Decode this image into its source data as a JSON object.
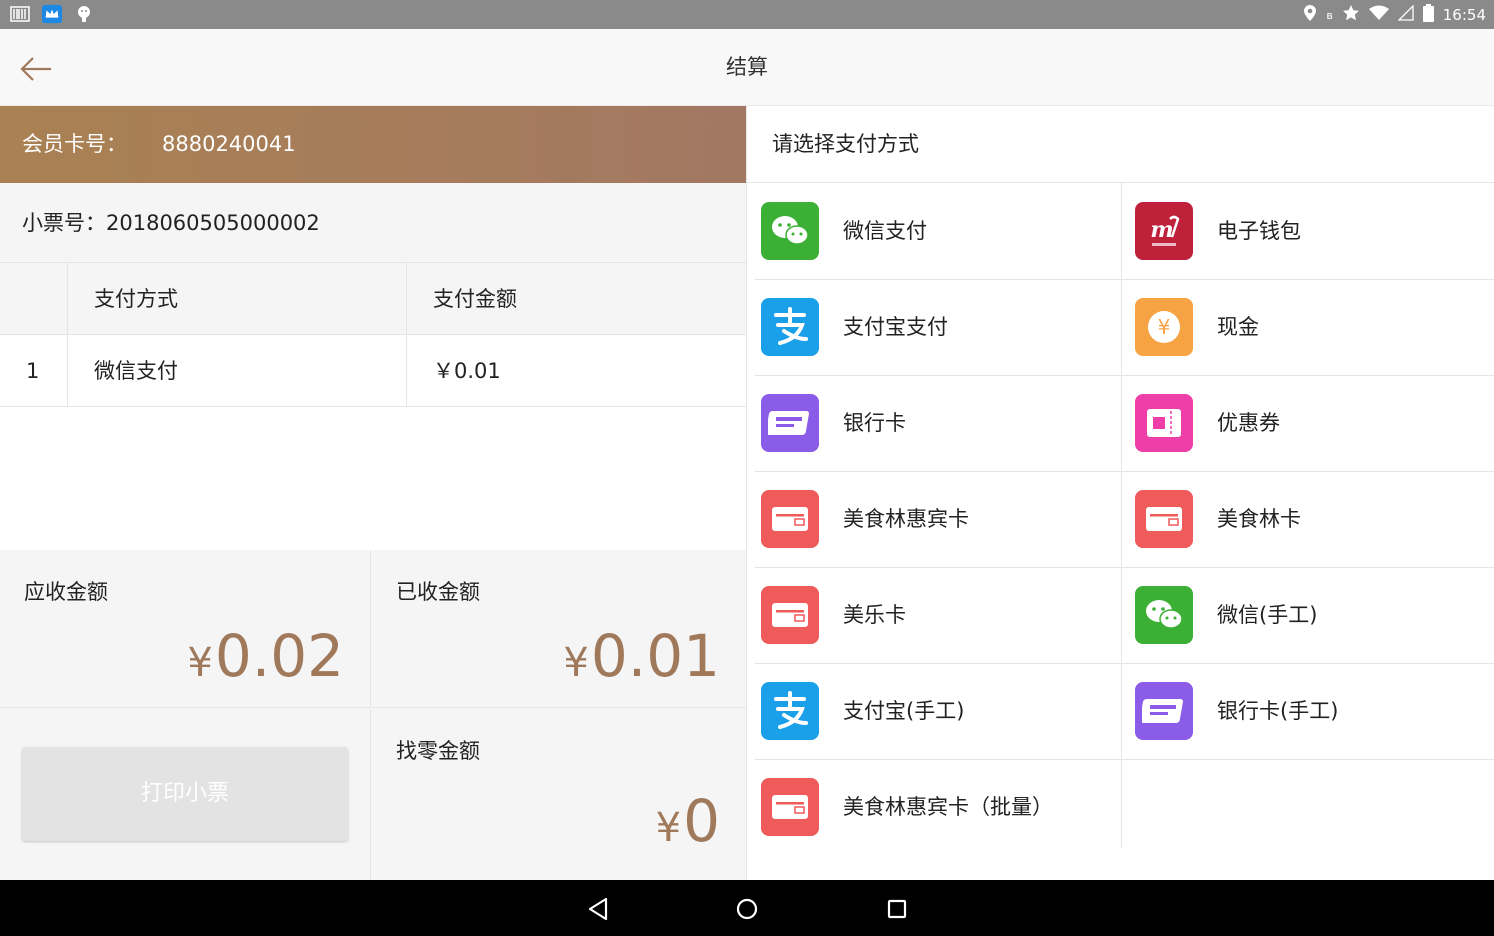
{
  "status_bar": {
    "time": "16:54"
  },
  "app_bar": {
    "title": "结算"
  },
  "member": {
    "label": "会员卡号：",
    "number": "8880240041"
  },
  "ticket": {
    "label": "小票号：",
    "number": "2018060505000002"
  },
  "payments_table": {
    "headers": {
      "index": "",
      "method": "支付方式",
      "amount": "支付金额"
    },
    "rows": [
      {
        "index": "1",
        "method": "微信支付",
        "amount": "￥0.01"
      }
    ]
  },
  "summary": {
    "receivable": {
      "label": "应收金额",
      "currency": "¥",
      "value": "0.02"
    },
    "received": {
      "label": "已收金额",
      "currency": "¥",
      "value": "0.01"
    },
    "change": {
      "label": "找零金额",
      "currency": "¥",
      "value": "0"
    },
    "print_button": "打印小票"
  },
  "payment_select": {
    "title": "请选择支付方式",
    "methods": [
      {
        "name": "微信支付",
        "icon": "wechat-icon",
        "color": "#3cb034"
      },
      {
        "name": "电子钱包",
        "icon": "wallet-logo-icon",
        "color": "#c0213a"
      },
      {
        "name": "支付宝支付",
        "icon": "alipay-icon",
        "color": "#1aa0e8"
      },
      {
        "name": "现金",
        "icon": "cash-icon",
        "color": "#f6a343"
      },
      {
        "name": "银行卡",
        "icon": "unionpay-icon",
        "color": "#8a5ce8"
      },
      {
        "name": "优惠券",
        "icon": "coupon-icon",
        "color": "#ee3fa8"
      },
      {
        "name": "美食林惠宾卡",
        "icon": "card-icon",
        "color": "#ef5a5a"
      },
      {
        "name": "美食林卡",
        "icon": "card-icon",
        "color": "#ef5a5a"
      },
      {
        "name": "美乐卡",
        "icon": "card-icon",
        "color": "#ef5a5a"
      },
      {
        "name": "微信(手工)",
        "icon": "wechat-icon",
        "color": "#3cb034"
      },
      {
        "name": "支付宝(手工)",
        "icon": "alipay-icon",
        "color": "#1aa0e8"
      },
      {
        "name": "银行卡(手工)",
        "icon": "unionpay-icon",
        "color": "#8a5ce8"
      },
      {
        "name": "美食林惠宾卡（批量）",
        "icon": "card-icon",
        "color": "#ef5a5a"
      }
    ]
  }
}
